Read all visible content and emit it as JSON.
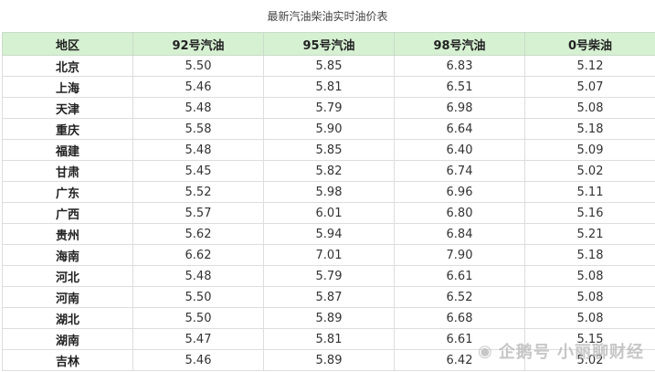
{
  "caption": "最新汽油柴油实时油价表",
  "table": {
    "headers": [
      "地区",
      "92号汽油",
      "95号汽油",
      "98号汽油",
      "0号柴油"
    ],
    "rows": [
      [
        "北京",
        "5.50",
        "5.85",
        "6.83",
        "5.12"
      ],
      [
        "上海",
        "5.46",
        "5.81",
        "6.51",
        "5.07"
      ],
      [
        "天津",
        "5.48",
        "5.79",
        "6.98",
        "5.08"
      ],
      [
        "重庆",
        "5.58",
        "5.90",
        "6.64",
        "5.18"
      ],
      [
        "福建",
        "5.48",
        "5.85",
        "6.40",
        "5.09"
      ],
      [
        "甘肃",
        "5.45",
        "5.82",
        "6.74",
        "5.02"
      ],
      [
        "广东",
        "5.52",
        "5.98",
        "6.96",
        "5.11"
      ],
      [
        "广西",
        "5.57",
        "6.01",
        "6.80",
        "5.16"
      ],
      [
        "贵州",
        "5.62",
        "5.94",
        "6.84",
        "5.21"
      ],
      [
        "海南",
        "6.62",
        "7.01",
        "7.90",
        "5.18"
      ],
      [
        "河北",
        "5.48",
        "5.79",
        "6.61",
        "5.08"
      ],
      [
        "河南",
        "5.50",
        "5.87",
        "6.52",
        "5.08"
      ],
      [
        "湖北",
        "5.50",
        "5.89",
        "6.68",
        "5.08"
      ],
      [
        "湖南",
        "5.47",
        "5.81",
        "6.61",
        "5.15"
      ],
      [
        "吉林",
        "5.46",
        "5.89",
        "6.42",
        "5.02"
      ]
    ]
  },
  "watermark": {
    "text": "企鹅号 小丽聊财经",
    "icon": "penguin-logo-icon"
  }
}
